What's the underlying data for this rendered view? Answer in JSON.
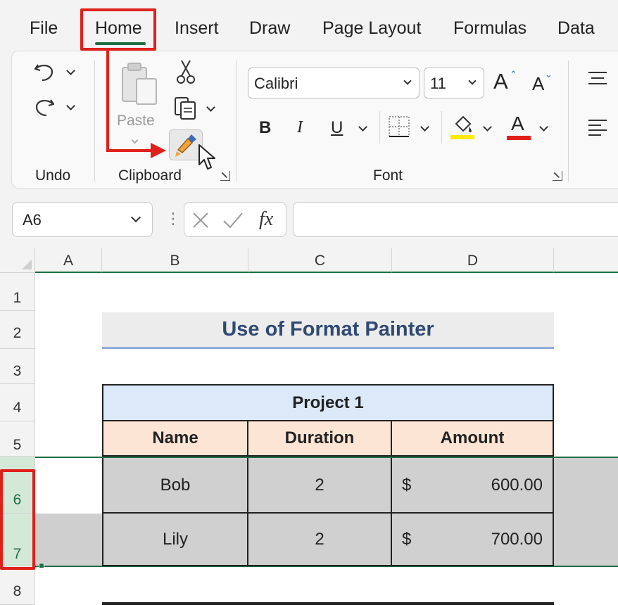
{
  "menu": {
    "items": [
      "File",
      "Home",
      "Insert",
      "Draw",
      "Page Layout",
      "Formulas",
      "Data"
    ],
    "active": "Home"
  },
  "ribbon": {
    "undo_group_label": "Undo",
    "clipboard_group_label": "Clipboard",
    "paste_label": "Paste",
    "font_group_label": "Font",
    "font_name": "Calibri",
    "font_size": "11",
    "bold_label": "B",
    "italic_label": "I",
    "underline_label": "U",
    "grow_font_label": "A",
    "shrink_font_label": "A",
    "font_color_label": "A",
    "highlight_color": "#ffeb00",
    "font_color": "#e0201b"
  },
  "formula_bar": {
    "name_box": "A6",
    "fx_label": "fx",
    "value": ""
  },
  "sheet": {
    "columns": [
      "A",
      "B",
      "C",
      "D"
    ],
    "rows": [
      "1",
      "2",
      "3",
      "4",
      "5",
      "6",
      "7",
      "8"
    ],
    "title": "Use of Format Painter",
    "project_header": "Project 1",
    "table_headers": [
      "Name",
      "Duration",
      "Amount"
    ],
    "table_rows": [
      {
        "name": "Bob",
        "duration": "2",
        "currency": "$",
        "amount": "600.00"
      },
      {
        "name": "Lily",
        "duration": "2",
        "currency": "$",
        "amount": "700.00"
      }
    ]
  },
  "colors": {
    "accent": "#1d6f42",
    "annotation": "#e0201b",
    "selected_row_header": "#d3e8d6"
  }
}
